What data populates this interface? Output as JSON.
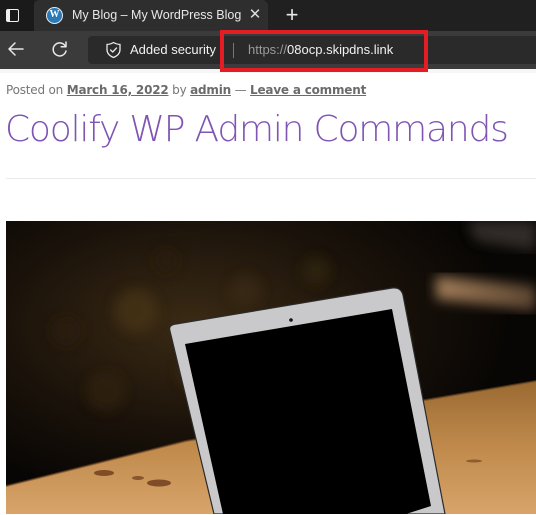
{
  "browser": {
    "tab": {
      "title": "My Blog – My WordPress Blog",
      "favicon": "wordpress-icon",
      "close_glyph": "✕"
    },
    "new_tab_glyph": "+",
    "address_bar": {
      "security_label": "Added security",
      "url_scheme": "https://",
      "url_host": "08ocp.skipdns.link"
    },
    "highlight_color": "#e41d25"
  },
  "post": {
    "meta": {
      "posted_on_label": "Posted on",
      "date": "March 16, 2022",
      "by_label": "by",
      "author": "admin",
      "separator": "—",
      "comment_link": "Leave a comment"
    },
    "title": "Coolify WP Admin Commands",
    "title_color": "#7f54b3",
    "featured_image": {
      "description": "Laptop with black screen on a wooden table against dark background",
      "icon": "image-laptop"
    }
  }
}
